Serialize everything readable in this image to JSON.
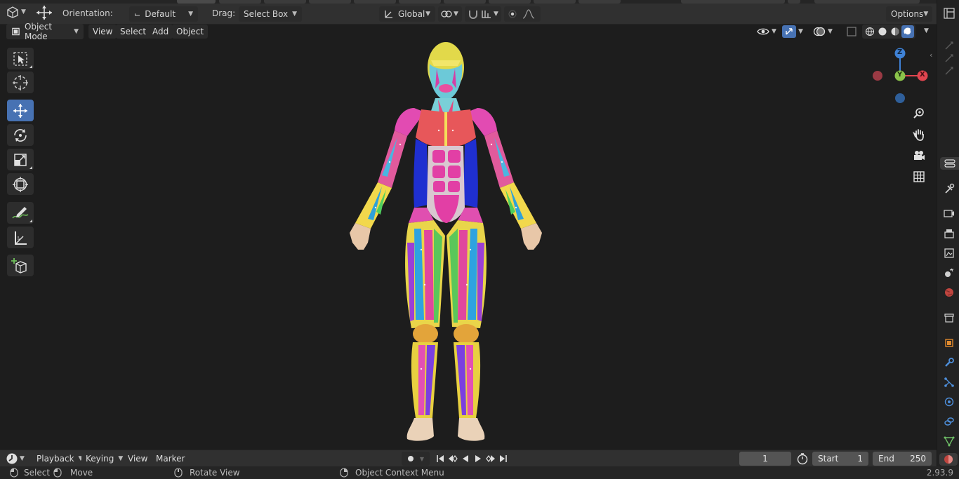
{
  "header": {
    "orientation_label": "Orientation:",
    "orientation_value": "Default",
    "drag_label": "Drag:",
    "drag_value": "Select Box",
    "transform_space": "Global",
    "options_label": "Options"
  },
  "viewport_menu": {
    "mode": "Object Mode",
    "items": [
      "View",
      "Select",
      "Add",
      "Object"
    ]
  },
  "gizmo": {
    "z": "Z",
    "y": "Y",
    "x": "X"
  },
  "timeline": {
    "menus": [
      "Playback",
      "Keying",
      "View",
      "Marker"
    ],
    "current_frame": "1",
    "start_label": "Start",
    "start_value": "1",
    "end_label": "End",
    "end_value": "250"
  },
  "status": {
    "select": "Select",
    "move": "Move",
    "rotate": "Rotate View",
    "context": "Object Context Menu",
    "version": "2.93.9"
  },
  "colors": {
    "active_tool": "#4772b3",
    "axis_x": "#e0454f",
    "axis_y": "#8bc34a",
    "axis_z": "#3f82d6"
  }
}
